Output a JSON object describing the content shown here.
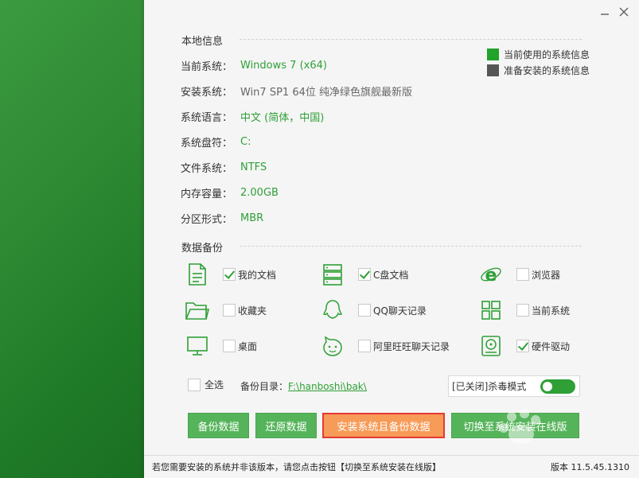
{
  "window": {
    "minimize_glyph": "−",
    "close_glyph": "✕"
  },
  "local_info": {
    "title": "本地信息",
    "rows": [
      {
        "label": "当前系统：",
        "value": "Windows 7 (x64)",
        "color": "green"
      },
      {
        "label": "安装系统：",
        "value": "Win7 SP1 64位 纯净绿色旗舰最新版",
        "color": "gray"
      },
      {
        "label": "系统语言：",
        "value": "中文 (简体，中国)",
        "color": "green"
      },
      {
        "label": "系统盘符：",
        "value": "C:",
        "color": "green"
      },
      {
        "label": "文件系统：",
        "value": "NTFS",
        "color": "green"
      },
      {
        "label": "内存容量：",
        "value": "2.00GB",
        "color": "green"
      },
      {
        "label": "分区形式：",
        "value": "MBR",
        "color": "green"
      }
    ],
    "legend": {
      "current": "当前使用的系统信息",
      "target": "准备安装的系统信息",
      "current_color": "#22a32b",
      "target_color": "#555555"
    }
  },
  "backup": {
    "title": "数据备份",
    "items": [
      {
        "label": "我的文档",
        "checked": true,
        "icon": "document-icon"
      },
      {
        "label": "C盘文档",
        "checked": true,
        "icon": "server-icon"
      },
      {
        "label": "浏览器",
        "checked": false,
        "icon": "ie-browser-icon"
      },
      {
        "label": "收藏夹",
        "checked": false,
        "icon": "folder-icon"
      },
      {
        "label": "QQ聊天记录",
        "checked": false,
        "icon": "qq-icon"
      },
      {
        "label": "当前系统",
        "checked": false,
        "icon": "windows-icon"
      },
      {
        "label": "桌面",
        "checked": false,
        "icon": "monitor-icon"
      },
      {
        "label": "阿里旺旺聊天记录",
        "checked": false,
        "icon": "wangwang-icon"
      },
      {
        "label": "硬件驱动",
        "checked": true,
        "icon": "hard-drive-icon"
      }
    ],
    "select_all": "全选",
    "dir_label": "备份目录：",
    "dir_path": "F:\\hanboshi\\bak\\",
    "antivirus_label": "[已关闭]杀毒模式",
    "antivirus_on": true
  },
  "buttons": {
    "backup": "备份数据",
    "restore": "还原数据",
    "install_backup": "安装系统且备份数据",
    "switch_online": "切换至系统安装在线版"
  },
  "footer": {
    "notice": "若您需要安装的系统并非该版本，请您点击按钮【切换至系统安装在线版】",
    "version": "版本 11.5.45.1310"
  },
  "colors": {
    "accent_green": "#2ea036",
    "button_green": "#55b45a",
    "primary_orange": "#f79b58",
    "highlight_red": "#e53935"
  }
}
